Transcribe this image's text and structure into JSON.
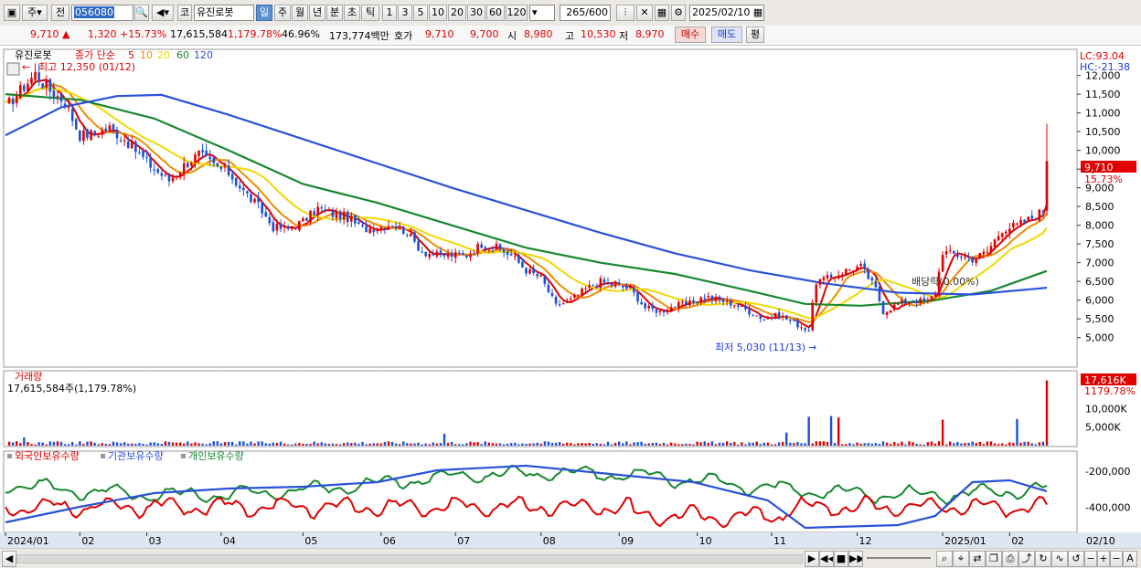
{
  "toolbar": {
    "market_label": "주",
    "prev_label": "전",
    "code_value": "056080",
    "kind_label": "코",
    "stock_name": "유진로봇",
    "period_buttons": [
      "일",
      "주",
      "월",
      "년",
      "분",
      "초",
      "틱"
    ],
    "minute_buttons": [
      "1",
      "3",
      "5",
      "10",
      "20",
      "30",
      "60",
      "120"
    ],
    "count_value": "265",
    "count_total": "/600",
    "date_value": "2025/02/10"
  },
  "quote": {
    "price": "9,710",
    "change_arrow": "▲",
    "change": "1,320",
    "change_rate": "+15.73%",
    "volume": "17,615,584",
    "volume_rate": "1,179.78%",
    "turnover_rate": "46.96%",
    "amount": "173,774백만",
    "ask_label": "호가",
    "ask1": "9,710",
    "ask2": "9,700",
    "open_label": "시",
    "open": "8,980",
    "high_label": "고",
    "high": "10,530",
    "low_label": "저",
    "low": "8,970",
    "buy_label": "매수",
    "sell_label": "매도",
    "eval_label": "평"
  },
  "chart_data": {
    "type": "line",
    "price_panel": {
      "name": "유진로봇",
      "legend_title": "종가 단순",
      "ma_periods": [
        "5",
        "10",
        "20",
        "60",
        "120"
      ],
      "ma_colors": [
        "#e00000",
        "#f08c00",
        "#f0d800",
        "#18882e",
        "#2a52d8"
      ],
      "ylim": [
        4700,
        12600
      ],
      "y_ticks": [
        5000,
        5500,
        6000,
        6500,
        7000,
        7500,
        8000,
        8500,
        9000,
        9500,
        10000,
        10500,
        11000,
        11500,
        12000
      ],
      "y_tick_labels": [
        "5,000",
        "5,500",
        "6,000",
        "6,500",
        "7,000",
        "7,500",
        "8,000",
        "8,500",
        "9,000",
        "9,500",
        "10,000",
        "10,500",
        "11,000",
        "11,500",
        "12,000"
      ],
      "max_label": "최고 12,350 (01/12)",
      "min_label": "최저 5,030 (11/13)",
      "dividend_label": "배당락(0.00%)",
      "lc_label": "LC:93.04",
      "hc_label": "HC:-21.38",
      "current_label": "9,710",
      "current_rate": "15.73%",
      "close_path": [
        {
          "x": 0,
          "v": 11150
        },
        {
          "x": 4,
          "v": 11600
        },
        {
          "x": 8,
          "v": 12050
        },
        {
          "x": 12,
          "v": 11600
        },
        {
          "x": 16,
          "v": 11300
        },
        {
          "x": 20,
          "v": 10400
        },
        {
          "x": 24,
          "v": 10450
        },
        {
          "x": 28,
          "v": 10600
        },
        {
          "x": 32,
          "v": 10300
        },
        {
          "x": 36,
          "v": 9900
        },
        {
          "x": 40,
          "v": 9500
        },
        {
          "x": 44,
          "v": 9200
        },
        {
          "x": 48,
          "v": 9600
        },
        {
          "x": 52,
          "v": 9900
        },
        {
          "x": 56,
          "v": 9600
        },
        {
          "x": 60,
          "v": 9400
        },
        {
          "x": 64,
          "v": 8900
        },
        {
          "x": 68,
          "v": 8500
        },
        {
          "x": 72,
          "v": 7950
        },
        {
          "x": 76,
          "v": 7900
        },
        {
          "x": 80,
          "v": 8100
        },
        {
          "x": 84,
          "v": 8450
        },
        {
          "x": 88,
          "v": 8300
        },
        {
          "x": 92,
          "v": 8200
        },
        {
          "x": 96,
          "v": 7900
        },
        {
          "x": 100,
          "v": 7950
        },
        {
          "x": 104,
          "v": 8050
        },
        {
          "x": 108,
          "v": 7800
        },
        {
          "x": 112,
          "v": 7300
        },
        {
          "x": 116,
          "v": 7200
        },
        {
          "x": 120,
          "v": 7200
        },
        {
          "x": 124,
          "v": 7200
        },
        {
          "x": 128,
          "v": 7500
        },
        {
          "x": 132,
          "v": 7400
        },
        {
          "x": 136,
          "v": 7200
        },
        {
          "x": 140,
          "v": 6800
        },
        {
          "x": 144,
          "v": 6600
        },
        {
          "x": 148,
          "v": 5850
        },
        {
          "x": 152,
          "v": 6000
        },
        {
          "x": 156,
          "v": 6300
        },
        {
          "x": 160,
          "v": 6500
        },
        {
          "x": 164,
          "v": 6400
        },
        {
          "x": 168,
          "v": 6300
        },
        {
          "x": 172,
          "v": 5800
        },
        {
          "x": 176,
          "v": 5700
        },
        {
          "x": 180,
          "v": 5850
        },
        {
          "x": 184,
          "v": 5900
        },
        {
          "x": 188,
          "v": 6100
        },
        {
          "x": 192,
          "v": 6000
        },
        {
          "x": 196,
          "v": 5900
        },
        {
          "x": 200,
          "v": 5700
        },
        {
          "x": 204,
          "v": 5500
        },
        {
          "x": 208,
          "v": 5600
        },
        {
          "x": 212,
          "v": 5400
        },
        {
          "x": 216,
          "v": 5200
        },
        {
          "x": 218,
          "v": 6500
        },
        {
          "x": 222,
          "v": 6600
        },
        {
          "x": 226,
          "v": 6800
        },
        {
          "x": 230,
          "v": 6900
        },
        {
          "x": 234,
          "v": 6300
        },
        {
          "x": 236,
          "v": 5700
        },
        {
          "x": 240,
          "v": 5900
        },
        {
          "x": 244,
          "v": 6000
        },
        {
          "x": 248,
          "v": 5950
        },
        {
          "x": 250,
          "v": 6200
        },
        {
          "x": 252,
          "v": 7300
        },
        {
          "x": 256,
          "v": 7200
        },
        {
          "x": 260,
          "v": 7100
        },
        {
          "x": 264,
          "v": 7300
        },
        {
          "x": 268,
          "v": 7900
        },
        {
          "x": 272,
          "v": 8000
        },
        {
          "x": 276,
          "v": 8200
        },
        {
          "x": 279,
          "v": 8400
        },
        {
          "x": 280,
          "v": 9710
        }
      ],
      "series": [
        {
          "name": "60",
          "points": [
            {
              "x": 0,
              "v": 11500
            },
            {
              "x": 20,
              "v": 11350
            },
            {
              "x": 40,
              "v": 10850
            },
            {
              "x": 60,
              "v": 10000
            },
            {
              "x": 80,
              "v": 9100
            },
            {
              "x": 100,
              "v": 8600
            },
            {
              "x": 120,
              "v": 8000
            },
            {
              "x": 140,
              "v": 7400
            },
            {
              "x": 160,
              "v": 7000
            },
            {
              "x": 180,
              "v": 6700
            },
            {
              "x": 200,
              "v": 6250
            },
            {
              "x": 215,
              "v": 5900
            },
            {
              "x": 230,
              "v": 5850
            },
            {
              "x": 250,
              "v": 6000
            },
            {
              "x": 265,
              "v": 6250
            },
            {
              "x": 280,
              "v": 6780
            }
          ]
        },
        {
          "name": "120",
          "points": [
            {
              "x": 0,
              "v": 10400
            },
            {
              "x": 15,
              "v": 11150
            },
            {
              "x": 30,
              "v": 11450
            },
            {
              "x": 42,
              "v": 11480
            },
            {
              "x": 60,
              "v": 10950
            },
            {
              "x": 80,
              "v": 10300
            },
            {
              "x": 100,
              "v": 9650
            },
            {
              "x": 120,
              "v": 9000
            },
            {
              "x": 140,
              "v": 8400
            },
            {
              "x": 160,
              "v": 7800
            },
            {
              "x": 180,
              "v": 7250
            },
            {
              "x": 200,
              "v": 6800
            },
            {
              "x": 220,
              "v": 6450
            },
            {
              "x": 240,
              "v": 6200
            },
            {
              "x": 260,
              "v": 6150
            },
            {
              "x": 280,
              "v": 6330
            }
          ]
        }
      ]
    },
    "volume_panel": {
      "name": "거래량",
      "readout": "17,615,584주(1,179.78%)",
      "ylim": [
        0,
        18000
      ],
      "y_tick_labels": [
        "5,000K",
        "10,000K"
      ],
      "current_label": "17,616K",
      "current_rate": "1179.78%",
      "spikes": [
        {
          "x": 5,
          "v": 2200
        },
        {
          "x": 118,
          "v": 3200
        },
        {
          "x": 210,
          "v": 3500
        },
        {
          "x": 216,
          "v": 7800
        },
        {
          "x": 222,
          "v": 8000
        },
        {
          "x": 224,
          "v": 7600
        },
        {
          "x": 252,
          "v": 7000
        },
        {
          "x": 272,
          "v": 7200
        },
        {
          "x": 280,
          "v": 17616
        }
      ]
    },
    "holding_panel": {
      "legend": [
        "외국인보유수량",
        "기관보유수량",
        "개인보유수량"
      ],
      "colors": [
        "#e00000",
        "#2a52d8",
        "#18882e"
      ],
      "ylim": [
        -520000,
        -120000
      ],
      "y_tick_labels": [
        "-200,000",
        "-400,000"
      ]
    },
    "x_axis": {
      "labels": [
        "2024/01",
        "02",
        "03",
        "04",
        "05",
        "06",
        "07",
        "08",
        "09",
        "10",
        "11",
        "12",
        "2025/01",
        "02",
        "02/10"
      ]
    }
  },
  "bottom": {
    "icons": [
      "play-icon",
      "prev-page-icon",
      "stop-icon",
      "next-page-icon"
    ]
  }
}
